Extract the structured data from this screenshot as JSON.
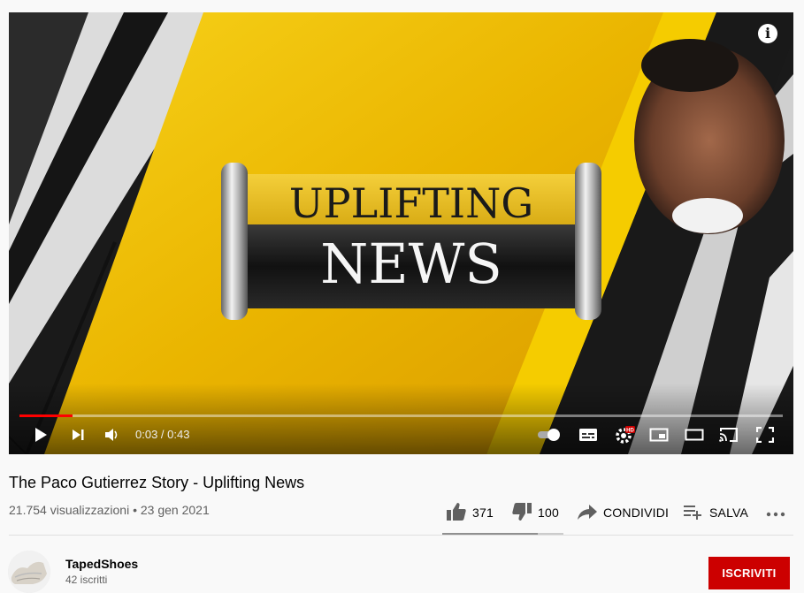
{
  "player": {
    "info_icon": "info-icon",
    "overlay_text_top": "UPLIFTING",
    "overlay_text_bottom": "NEWS",
    "time_display": "0:03 / 0:43",
    "progress_fraction": 0.07,
    "controls": [
      "play-icon",
      "next-icon",
      "volume-icon",
      "autoplay-toggle-icon",
      "subtitles-icon",
      "settings-icon",
      "miniplayer-icon",
      "theater-mode-icon",
      "cast-icon",
      "fullscreen-icon"
    ],
    "settings_badge": "HD"
  },
  "video": {
    "title": "The Paco Gutierrez Story - Uplifting News",
    "views": "21.754 visualizzazioni",
    "separator": "•",
    "date": "23 gen 2021"
  },
  "actions": {
    "likes": "371",
    "dislikes": "100",
    "share_label": "CONDIVIDI",
    "save_label": "SALVA",
    "like_fraction": 0.79
  },
  "channel": {
    "name": "TapedShoes",
    "subscribers": "42 iscritti",
    "subscribe_label": "ISCRIVITI"
  },
  "colors": {
    "brand_red": "#cc0000",
    "progress_red": "#ff0000",
    "banner_yellow": "#f2c200",
    "secondary_text": "#606060"
  }
}
